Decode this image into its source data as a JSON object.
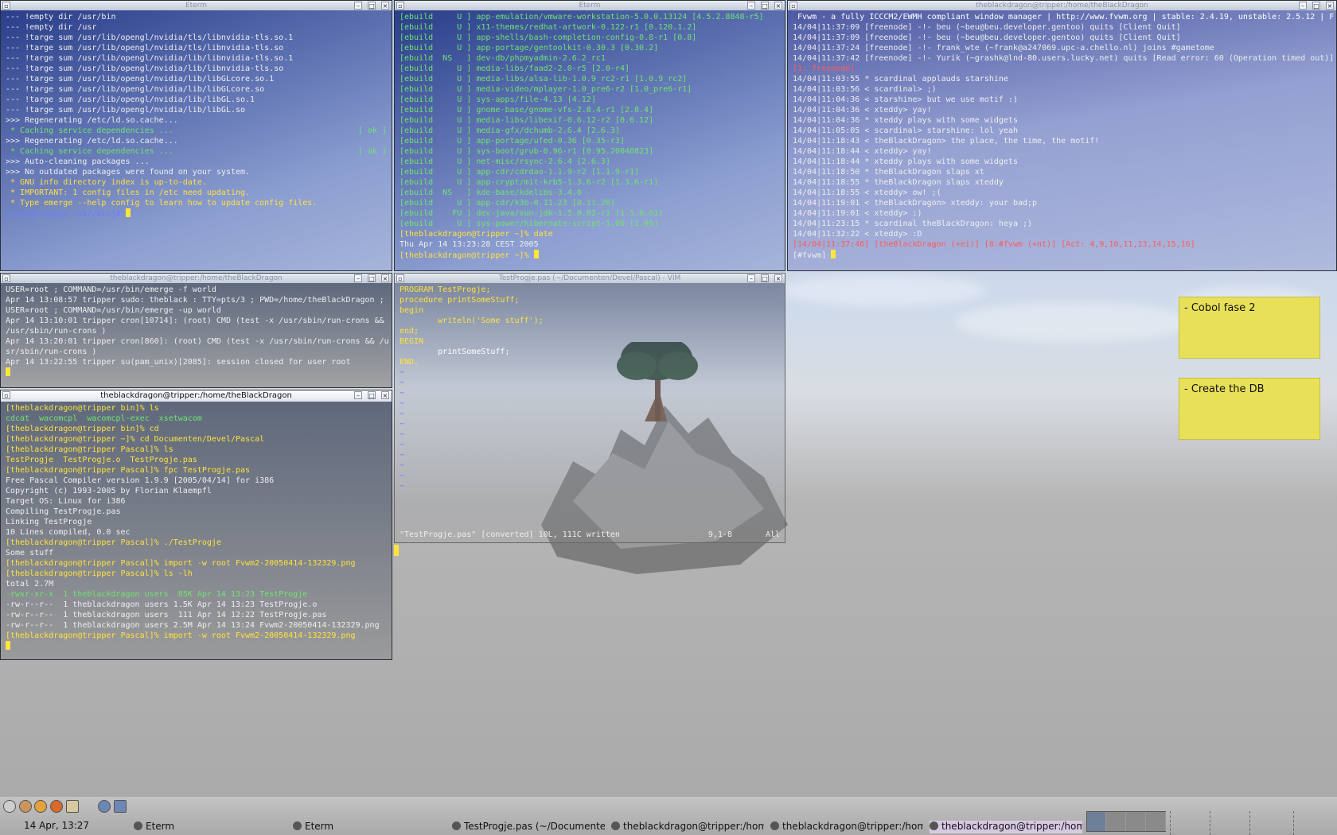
{
  "windows": {
    "eterm1": {
      "title": "Eterm",
      "lines": [
        "--- !empty dir /usr/bin",
        "--- !empty dir /usr",
        "--- !targe sum /usr/lib/opengl/nvidia/tls/libnvidia-tls.so.1",
        "--- !targe sum /usr/lib/opengl/nvidia/tls/libnvidia-tls.so",
        "--- !targe sum /usr/lib/opengl/nvidia/lib/libnvidia-tls.so.1",
        "--- !targe sum /usr/lib/opengl/nvidia/lib/libnvidia-tls.so",
        "--- !targe sum /usr/lib/opengl/nvidia/lib/libGLcore.so.1",
        "--- !targe sum /usr/lib/opengl/nvidia/lib/libGLcore.so",
        "--- !targe sum /usr/lib/opengl/nvidia/lib/libGL.so.1",
        "--- !targe sum /usr/lib/opengl/nvidia/lib/libGL.so",
        ">>> Regenerating /etc/ld.so.cache...",
        " * Caching service dependencies ...",
        ">>> Regenerating /etc/ld.so.cache...",
        " * Caching service dependencies ...",
        ">>> Auto-cleaning packages ...",
        "",
        ">>> No outdated packages were found on your system.",
        "",
        "",
        " * GNU info directory index is up-to-date.",
        " * IMPORTANT: 1 config files in /etc need updating.",
        " * Type emerge --help config to learn how to update config files.",
        "",
        "[root@tripper /usr/bin]# "
      ],
      "ok": "[ ok ]"
    },
    "eterm2": {
      "title": "Eterm",
      "lines": [
        "[ebuild     U ] app-emulation/vmware-workstation-5.0.0.13124 [4.5.2.8848-r5]",
        "[ebuild     U ] x11-themes/redhat-artwork-0.122-r1 [0.120.1.2]",
        "[ebuild     U ] app-shells/bash-completion-config-0.8-r1 [0.8]",
        "[ebuild     U ] app-portage/gentoolkit-0.30.3 [0.30.2]",
        "[ebuild  NS   ] dev-db/phpmyadmin-2.6.2_rc1",
        "[ebuild     U ] media-libs/faad2-2.0-r5 [2.0-r4]",
        "[ebuild     U ] media-libs/alsa-lib-1.0.9_rc2-r1 [1.0.9_rc2]",
        "[ebuild     U ] media-video/mplayer-1.0_pre6-r2 [1.0_pre6-r1]",
        "[ebuild     U ] sys-apps/file-4.13 [4.12]",
        "[ebuild     U ] gnome-base/gnome-vfs-2.8.4-r1 [2.8.4]",
        "[ebuild     U ] media-libs/libexif-0.6.12-r2 [0.6.12]",
        "[ebuild     U ] media-gfx/dchumb-2.6.4 [2.6.3]",
        "[ebuild     U ] app-portage/ufed-0.36 [0.35-r3]",
        "[ebuild     U ] sys-boot/grub-0.96-r1 [0.95.20040823]",
        "[ebuild     U ] net-misc/rsync-2.6.4 [2.6.3]",
        "[ebuild     U ] app-cdr/cdrdao-1.1.9-r2 [1.1.9-r1]",
        "[ebuild     U ] app-crypt/mit-krb5-1.3.6-r2 [1.3.6-r1]",
        "[ebuild  NS   ] kde-base/kdelibs-3.4.0",
        "[ebuild     U ] app-cdr/k3b-0.11.23 [0.11.20]",
        "[ebuild    FU ] dev-java/sun-jdk-1.5.0.02-r1 [1.5.0.01]",
        "[ebuild     U ] sys-power/hibernate-script-1.06 [1.05]",
        "[theblackdragon@tripper ~]% date",
        "Thu Apr 14 13:23:28 CEST 2005",
        "[theblackdragon@tripper ~]% "
      ]
    },
    "irc": {
      "title": "theblackdragon@tripper:/home/theBlackDragon",
      "lines": [
        " Fvwm - a fully ICCCM2/EWMH compliant window manager | http://www.fvwm.org | stable: 2.4.19, unstable: 2.5.12 | F",
        "14/04|11:37:09 [freenode] -!- beu (~beu@beu.developer.gentoo) quits [Client Quit]",
        "14/04|11:37:09 [freenode] -!- beu (~beu@beu.developer.gentoo) quits [Client Quit]",
        "14/04|11:37:24 [freenode] -!- frank_wte (~frank@a247069.upc-a.chello.nl) joins #gametome",
        "14/04|11:37:42 [freenode] -!- Yurik (~grashk@lnd-80.users.lucky.net) quits [Read error: 60 (Operation timed out)]",
        "[1: freenode]",
        "14/04|11:03:55 * scardinal applauds starshine",
        "14/04|11:03:56 < scardinal> ;)",
        "14/04|11:04:36 < starshine> but we use motif :)",
        "14/04|11:04:36 < xteddy> yay!",
        "14/04|11:04:36 * xteddy plays with some widgets",
        "14/04|11:05:05 < scardinal> starshine: lol yeah",
        "14/04|11:18:43 < theBlackDragon> the place, the time, the motif!",
        "14/04|11:18:44 < xteddy> yay!",
        "14/04|11:18:44 * xteddy plays with some widgets",
        "14/04|11:18:50 * theBlackDragon slaps xt",
        "14/04|11:18:55 * theBlackDragon slaps xteddy",
        "14/04|11:18:55 < xteddy> ow! ;(",
        "14/04|11:19:01 < theBlackDragon> xteddy: your bad;p",
        "14/04|11:19:01 < xteddy> :)",
        "14/04|11:23:15 * scardinal theBlackDragon: heya ;)",
        "14/04|11:32:22 < xteddy> :D",
        "[14/04|11:37:46] [theBlackDragon (+ei)] [8:#fvwm (+nt)] [Act: 4,9,10,11,13,14,15,16]",
        "[#fvwm] "
      ]
    },
    "log": {
      "title": "theblackdragon@tripper:/home/theBlackDragon",
      "lines": [
        "USER=root ; COMMAND=/usr/bin/emerge -f world",
        "Apr 14 13:08:57 tripper sudo: theblack : TTY=pts/3 ; PWD=/home/theBlackDragon ;",
        "USER=root ; COMMAND=/usr/bin/emerge -up world",
        "Apr 14 13:10:01 tripper cron[10714]: (root) CMD (test -x /usr/sbin/run-crons &&",
        "/usr/sbin/run-crons )",
        "Apr 14 13:20:01 tripper cron[860]: (root) CMD (test -x /usr/sbin/run-crons && /u",
        "sr/sbin/run-crons )",
        "Apr 14 13:22:55 tripper su(pam_unix)[2085]: session closed for user root"
      ]
    },
    "shell": {
      "title": "theblackdragon@tripper:/home/theBlackDragon",
      "lines": [
        "[theblackdragon@tripper bin]% ls",
        "cdcat  wacomcpl  wacomcpl-exec  xsetwacom",
        "[theblackdragon@tripper bin]% cd",
        "[theblackdragon@tripper ~]% cd Documenten/Devel/Pascal",
        "[theblackdragon@tripper Pascal]% ls",
        "TestProgje  TestProgje.o  TestProgje.pas",
        "[theblackdragon@tripper Pascal]% fpc TestProgje.pas",
        "Free Pascal Compiler version 1.9.9 [2005/04/14] for i386",
        "Copyright (c) 1993-2005 by Florian Klaempfl",
        "Target OS: Linux for i386",
        "Compiling TestProgje.pas",
        "Linking TestProgje",
        "10 Lines compiled, 0.0 sec",
        "[theblackdragon@tripper Pascal]% ./TestProgje",
        "Some stuff",
        "[theblackdragon@tripper Pascal]% import -w root Fvwm2-20050414-132329.png",
        "[theblackdragon@tripper Pascal]% ls -lh",
        "total 2.7M",
        "-rwxr-xr-x  1 theblackdragon users  85K Apr 14 13:23 TestProgje",
        "-rw-r--r--  1 theblackdragon users 1.5K Apr 14 13:23 TestProgje.o",
        "-rw-r--r--  1 theblackdragon users  111 Apr 14 12:22 TestProgje.pas",
        "-rw-r--r--  1 theblackdragon users 2.5M Apr 14 13:24 Fvwm2-20050414-132329.png",
        "[theblackdragon@tripper Pascal]% import -w root Fvwm2-20050414-132329.png"
      ]
    },
    "vim": {
      "title": "TestProgje.pas (~/Documenten/Devel/Pascal) - VIM",
      "lines": [
        "PROGRAM TestProgje;",
        "",
        "procedure printSomeStuff;",
        "begin",
        "        writeln('Some stuff');",
        "end;",
        "",
        "BEGIN",
        "        printSomeStuff;",
        "END.",
        "~",
        "~",
        "~",
        "~",
        "~",
        "~",
        "~",
        "~",
        "~",
        "~",
        "~",
        "~",
        "~"
      ],
      "status_left": "\"TestProgje.pas\" [converted] 10L, 111C written",
      "status_pos": "9,1-8",
      "status_all": "All"
    }
  },
  "notes": [
    {
      "text": "- Cobol fase 2"
    },
    {
      "text": "- Create the DB"
    }
  ],
  "taskbar": {
    "clock": "14 Apr, 13:27",
    "tasks": [
      {
        "label": "Eterm"
      },
      {
        "label": "Eterm"
      },
      {
        "label": "TestProgje.pas (~/Documenten/Dev"
      },
      {
        "label": "theblackdragon@tripper:/home/the"
      },
      {
        "label": "theblackdragon@tripper:/home/the"
      },
      {
        "label": "theblackdragon@tripper:/home/the"
      }
    ],
    "launchers": [
      "terminal-icon",
      "browser-icon",
      "paint-icon",
      "firefox-icon",
      "home-icon",
      "refresh-icon",
      "screen-icon"
    ]
  },
  "colors": {
    "accent_yellow": "#ffe13d",
    "note_yellow": "#e9e05a",
    "green": "#6fe46f"
  }
}
